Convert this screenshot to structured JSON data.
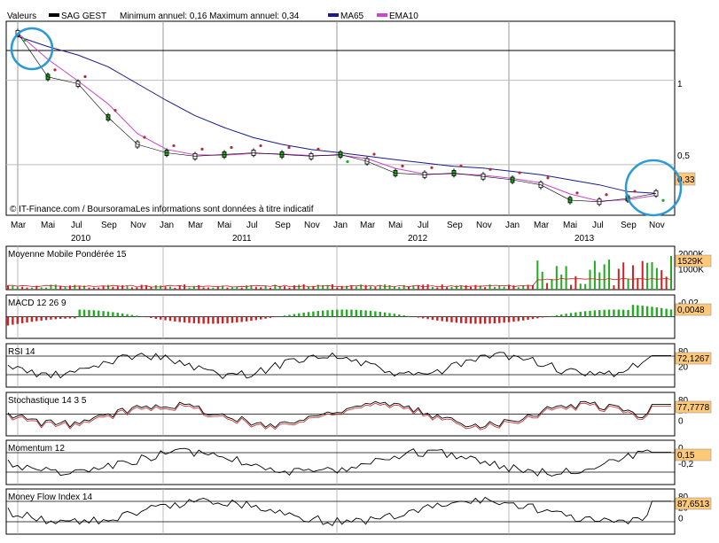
{
  "legend": {
    "label": "Valeurs",
    "series_name": "SAG GEST",
    "minmax": "Minimum annuel: 0,16 Maximum annuel: 0,34",
    "ma_name": "MA65",
    "ema_name": "EMA10",
    "colors": {
      "price": "#000000",
      "ma": "#1a1a8c",
      "ema": "#cc44cc"
    }
  },
  "watermark": "© IT-Finance.com / BoursoramaLes informations sont données à titre indicatif",
  "x_axis": {
    "months": [
      "Mar",
      "Mai",
      "Jul",
      "Sep",
      "Nov",
      "Jan",
      "Mar",
      "Mai",
      "Jul",
      "Sep",
      "Nov",
      "Jan",
      "Mar",
      "Mai",
      "Jul",
      "Sep",
      "Nov",
      "Jan",
      "Mar",
      "Mai",
      "Jul",
      "Sep",
      "Nov"
    ],
    "years": [
      "2010",
      "2011",
      "2012",
      "2013"
    ]
  },
  "main_panel": {
    "y_labels": [
      "1",
      "0,5"
    ],
    "last_value": "0,33"
  },
  "panels": [
    {
      "title": "Moyenne Mobile Pondérée 15",
      "y_labels": [
        "2000K",
        "1000K"
      ],
      "last_value": "1529K"
    },
    {
      "title": "MACD 12 26 9",
      "y_labels": [
        "-0,02"
      ],
      "last_value": "0,0048"
    },
    {
      "title": "RSI 14",
      "y_labels": [
        "80",
        "20"
      ],
      "last_value": "72,1267"
    },
    {
      "title": "Stochastique 14 3 5",
      "y_labels": [
        "80",
        "20",
        "0"
      ],
      "last_value": "77,7778"
    },
    {
      "title": "Momentum 12",
      "y_labels": [
        "0",
        "-0,2"
      ],
      "last_value": "0,15"
    },
    {
      "title": "Money Flow Index 14",
      "y_labels": [
        "80",
        "20",
        "0"
      ],
      "last_value": "87,6513"
    }
  ],
  "colors": {
    "highlight_circle": "#2a9ad6",
    "value_box": "#fdc978",
    "up": "#22aa22",
    "down": "#cc2222",
    "sar": "#b03030",
    "grid": "#aaaaaa"
  },
  "chart_data": [
    {
      "type": "line",
      "series": [
        {
          "name": "SAG GEST",
          "x": [
            "2010-03",
            "2010-05",
            "2010-07",
            "2010-09",
            "2010-11",
            "2011-01",
            "2011-03",
            "2011-05",
            "2011-07",
            "2011-09",
            "2011-11",
            "2012-01",
            "2012-03",
            "2012-05",
            "2012-07",
            "2012-09",
            "2012-11",
            "2013-01",
            "2013-03",
            "2013-05",
            "2013-07",
            "2013-09",
            "2013-10"
          ],
          "values": [
            1.28,
            1.02,
            0.98,
            0.78,
            0.62,
            0.57,
            0.55,
            0.56,
            0.57,
            0.56,
            0.55,
            0.56,
            0.52,
            0.45,
            0.44,
            0.45,
            0.43,
            0.41,
            0.38,
            0.29,
            0.28,
            0.3,
            0.33
          ]
        },
        {
          "name": "MA65",
          "x": [
            "2010-03",
            "2010-05",
            "2010-07",
            "2010-09",
            "2010-11",
            "2011-01",
            "2011-03",
            "2011-05",
            "2011-07",
            "2011-09",
            "2011-11",
            "2012-01",
            "2012-03",
            "2012-05",
            "2012-07",
            "2012-09",
            "2012-11",
            "2013-01",
            "2013-03",
            "2013-05",
            "2013-07",
            "2013-09",
            "2013-10"
          ],
          "values": [
            1.26,
            1.2,
            1.15,
            1.08,
            0.98,
            0.88,
            0.79,
            0.72,
            0.66,
            0.62,
            0.59,
            0.57,
            0.55,
            0.53,
            0.51,
            0.49,
            0.48,
            0.46,
            0.44,
            0.41,
            0.38,
            0.34,
            0.33
          ]
        }
      ],
      "ylim": [
        0.2,
        1.35
      ],
      "y_ticks": [
        1,
        0.5
      ],
      "last_value": 0.33
    },
    {
      "type": "bar",
      "title": "Moyenne Mobile Pondérée 15",
      "last_value": "1529K",
      "ylim": [
        0,
        2000
      ]
    },
    {
      "type": "bar",
      "title": "MACD 12 26 9",
      "last_value": 0.0048
    },
    {
      "type": "line",
      "title": "RSI 14",
      "last_value": 72.1267,
      "ylim": [
        0,
        100
      ]
    },
    {
      "type": "line",
      "title": "Stochastique 14 3 5",
      "last_value": 77.7778,
      "ylim": [
        0,
        100
      ]
    },
    {
      "type": "line",
      "title": "Momentum 12",
      "last_value": 0.15
    },
    {
      "type": "line",
      "title": "Money Flow Index 14",
      "last_value": 87.6513,
      "ylim": [
        0,
        100
      ]
    }
  ]
}
